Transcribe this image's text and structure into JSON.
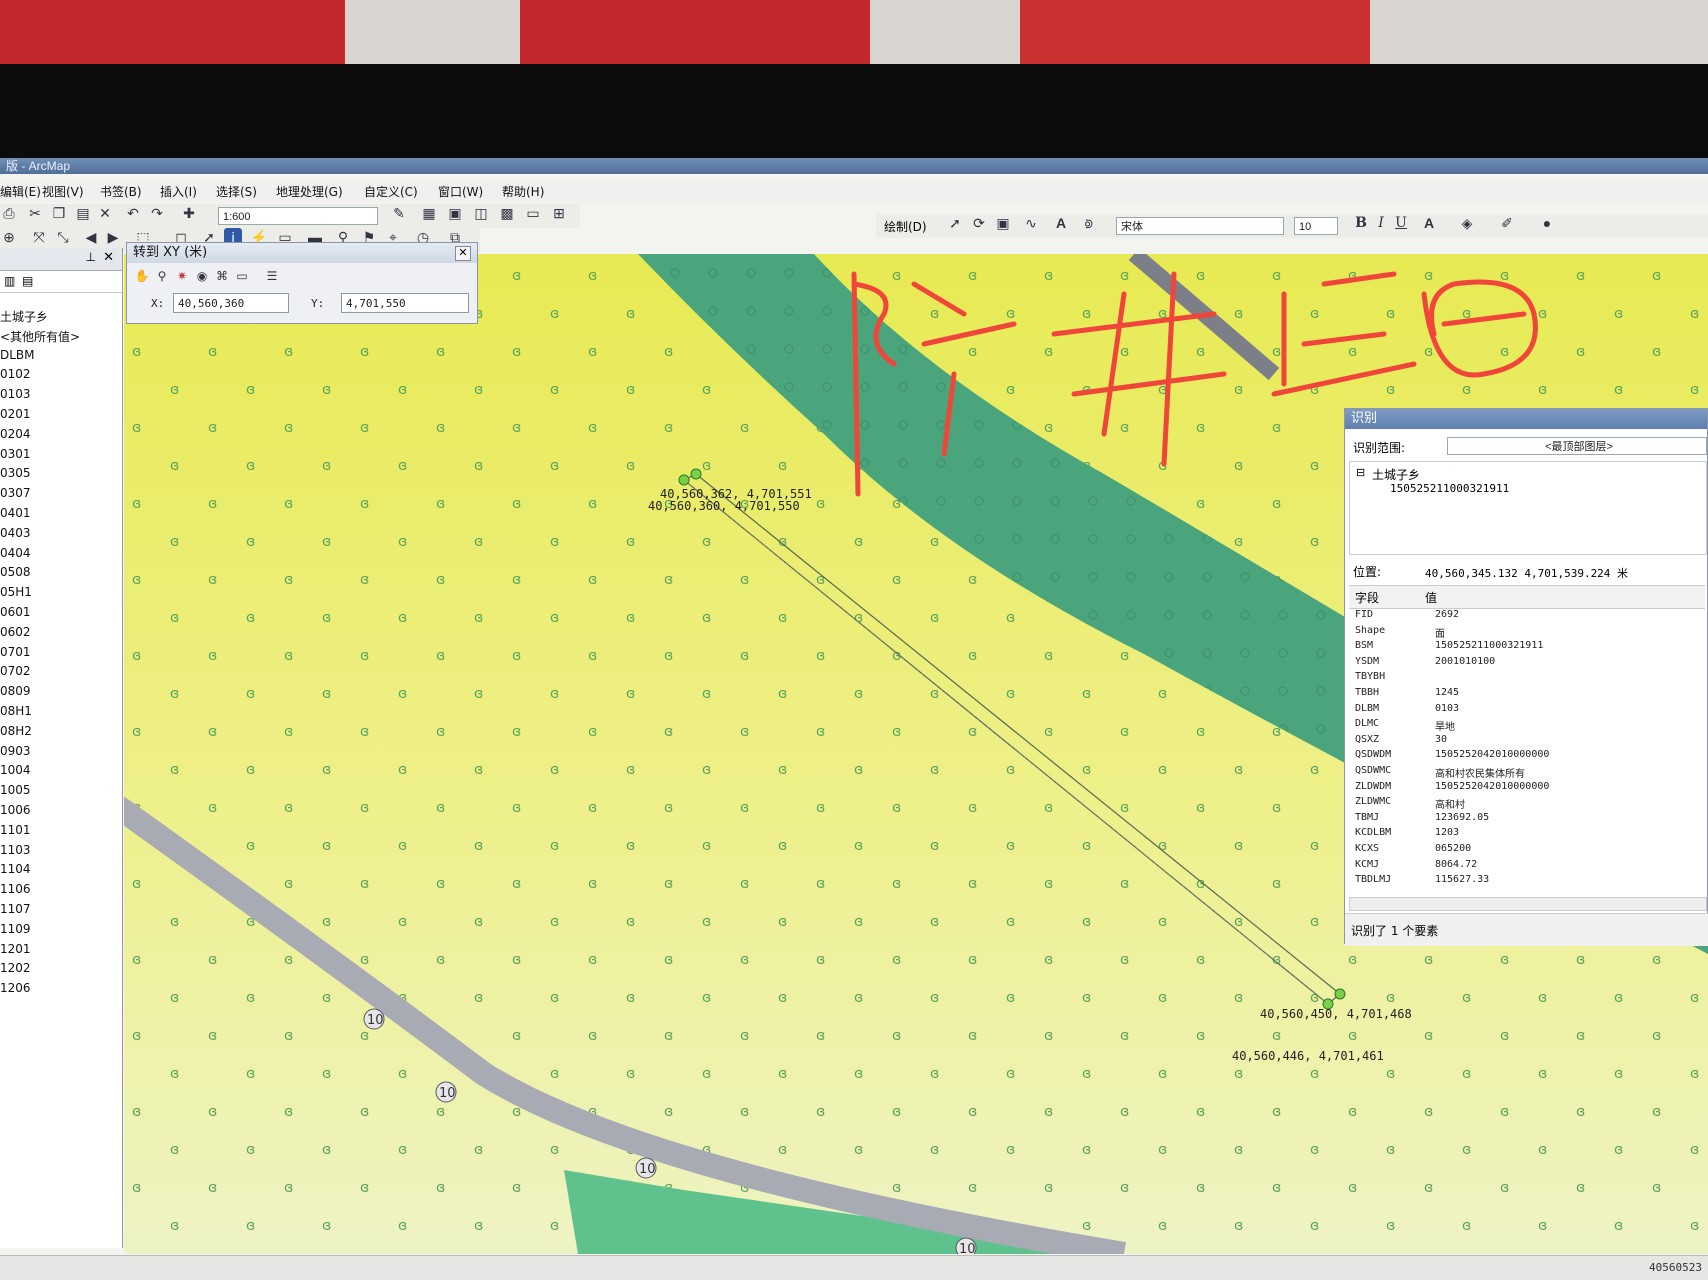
{
  "window": {
    "title": "版 - ArcMap"
  },
  "menu": [
    "编辑(E)",
    "视图(V)",
    "书签(B)",
    "插入(I)",
    "选择(S)",
    "地理处理(G)",
    "自定义(C)",
    "窗口(W)",
    "帮助(H)"
  ],
  "toolbar": {
    "scale": "1:600",
    "draw_label": "绘制(D)",
    "font": "宋体",
    "font_size": "10",
    "bold": "B",
    "italic": "I",
    "underline": "U",
    "font_color": "A"
  },
  "toc": {
    "items": [
      "土城子乡",
      "<其他所有值>",
      "DLBM",
      "0102",
      "0103",
      "0201",
      "0204",
      "0301",
      "0305",
      "0307",
      "0401",
      "0403",
      "0404",
      "0508",
      "05H1",
      "0601",
      "0602",
      "0701",
      "0702",
      "0809",
      "08H1",
      "08H2",
      "0903",
      "1004",
      "1005",
      "1006",
      "1101",
      "1103",
      "1104",
      "1106",
      "1107",
      "1109",
      "1201",
      "1202",
      "1206"
    ]
  },
  "goto_xy": {
    "title": "转到 XY (米)",
    "x_label": "X:",
    "x_value": "40,560,360",
    "y_label": "Y:",
    "y_value": "4,701,550"
  },
  "map": {
    "coord_labels": [
      "40,560,362, 4,701,551",
      "40,560,360, 4,701,550",
      "40,560,450, 4,701,468",
      "40,560,446, 4,701,461"
    ],
    "road_label": "10",
    "colors": {
      "farmland": "#e9ec5c",
      "green_band": "#4aa57c",
      "light_green": "#66c98f",
      "road": "#a8aab4",
      "annotation": "#f0453a"
    },
    "handwriting": "陈 井 后 日"
  },
  "identify": {
    "title": "识别",
    "scope_label": "识别范围:",
    "scope_value": "<最顶部图层>",
    "tree_root": "土城子乡",
    "tree_child": "150525211000321911",
    "location_label": "位置:",
    "location_value": "40,560,345.132  4,701,539.224 米",
    "field_header": "字段",
    "value_header": "值",
    "rows": [
      {
        "field": "FID",
        "value": "2692"
      },
      {
        "field": "Shape",
        "value": "面"
      },
      {
        "field": "BSM",
        "value": "150525211000321911"
      },
      {
        "field": "YSDM",
        "value": "2001010100"
      },
      {
        "field": "TBYBH",
        "value": ""
      },
      {
        "field": "TBBH",
        "value": "1245"
      },
      {
        "field": "DLBM",
        "value": "0103"
      },
      {
        "field": "DLMC",
        "value": "旱地"
      },
      {
        "field": "QSXZ",
        "value": "30"
      },
      {
        "field": "QSDWDM",
        "value": "1505252042010000000"
      },
      {
        "field": "QSDWMC",
        "value": "高和村农民集体所有"
      },
      {
        "field": "ZLDWDM",
        "value": "1505252042010000000"
      },
      {
        "field": "ZLDWMC",
        "value": "高和村"
      },
      {
        "field": "TBMJ",
        "value": "123692.05"
      },
      {
        "field": "KCDLBM",
        "value": "1203"
      },
      {
        "field": "KCXS",
        "value": "065200"
      },
      {
        "field": "KCMJ",
        "value": "8064.72"
      },
      {
        "field": "TBDLMJ",
        "value": "115627.33"
      }
    ],
    "status": "识别了 1 个要素"
  },
  "statusbar": {
    "coords": "40560523"
  }
}
